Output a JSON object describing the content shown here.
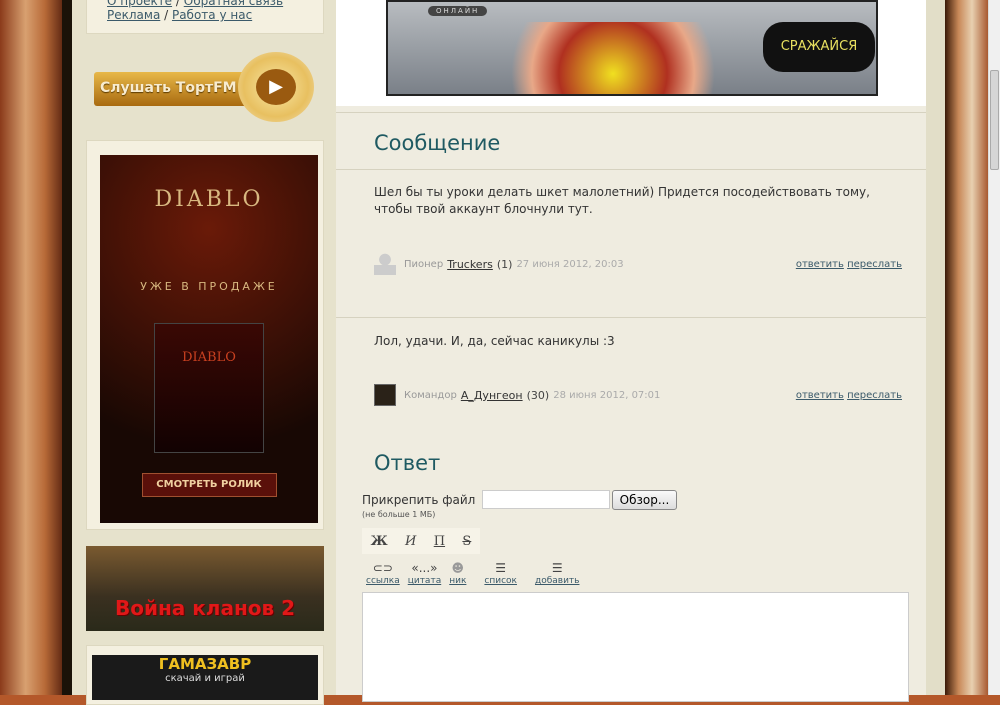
{
  "sidebar": {
    "links_row1": [
      "О проекте",
      "Обратная связь"
    ],
    "links_row2": [
      "Реклама",
      "Работа у нас"
    ],
    "radio_label": "Слушать ТортFM",
    "ads": {
      "diablo_title": "DIABLO",
      "diablo_tagline": "УЖЕ В ПРОДАЖЕ",
      "diablo_button": "СМОТРЕТЬ РОЛИК",
      "clan_wars": "Война кланов 2",
      "gamazavr_title": "ГАМАЗАВР",
      "gamazavr_sub": "скачай и играй"
    }
  },
  "banner": {
    "subtitle": "ОНЛАЙН",
    "cta": "СРАЖАЙСЯ"
  },
  "message_section": {
    "title": "Сообщение"
  },
  "messages": [
    {
      "text": "Шел бы ты уроки делать шкет малолетний) Придется посодействовать тому, чтобы твой аккаунт блочнули тут.",
      "rank": "Пионер",
      "user": "Truckers",
      "count": "(1)",
      "date": "27 июня 2012, 20:03",
      "reply": "ответить",
      "forward": "переслать"
    },
    {
      "text": "Лол, удачи. И, да, сейчас каникулы :3",
      "rank": "Командор",
      "user": "А_Дунгеон",
      "count": "(30)",
      "date": "28 июня 2012, 07:01",
      "reply": "ответить",
      "forward": "переслать"
    }
  ],
  "reply": {
    "title": "Ответ",
    "attach_label": "Прикрепить файл",
    "attach_note": "(не больше 1 МБ)",
    "browse": "Обзор...",
    "format": [
      "Ж",
      "И",
      "П",
      "S"
    ],
    "tools": [
      {
        "icon": "⊂⊃",
        "label": "ссылка"
      },
      {
        "icon": "«...»",
        "label": "цитата"
      },
      {
        "icon": "☻",
        "label": "ник"
      },
      {
        "icon": "☰",
        "label": "список"
      },
      {
        "icon": "☰",
        "label": "добавить"
      }
    ]
  }
}
